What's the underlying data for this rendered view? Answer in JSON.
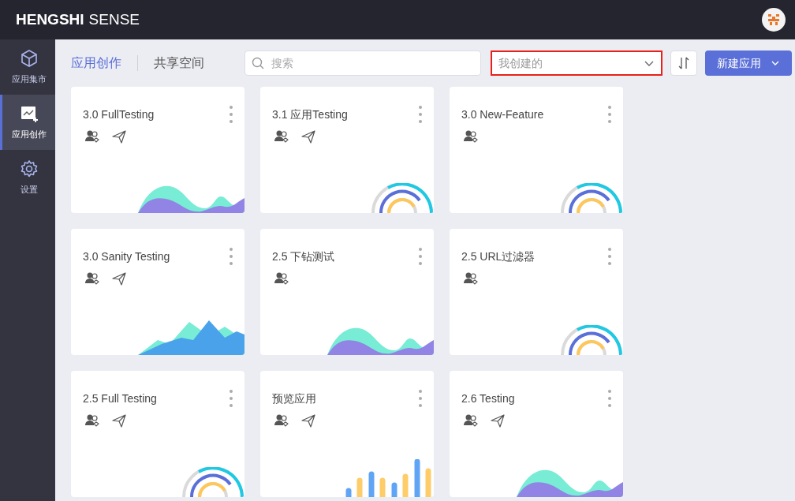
{
  "brand": {
    "bold": "HENGSHI",
    "light": "SENSE"
  },
  "sidebar": {
    "items": [
      {
        "label": "应用集市",
        "selected": false
      },
      {
        "label": "应用创作",
        "selected": true
      },
      {
        "label": "设置",
        "selected": false
      }
    ]
  },
  "tabs": [
    {
      "label": "应用创作",
      "selected": true
    },
    {
      "label": "共享空间",
      "selected": false
    }
  ],
  "search": {
    "placeholder": "搜索"
  },
  "filter": {
    "value": "我创建的",
    "highlighted": true
  },
  "new_button": "新建应用",
  "apps": [
    {
      "title": "3.0 FullTesting",
      "published": true,
      "kind": "wave"
    },
    {
      "title": "3.1 应用Testing",
      "published": true,
      "kind": "rings"
    },
    {
      "title": "3.0 New-Feature",
      "published": false,
      "kind": "rings"
    },
    {
      "title": "3.0 Sanity Testing",
      "published": true,
      "kind": "mountain"
    },
    {
      "title": "2.5 下钻测试",
      "published": false,
      "kind": "wave"
    },
    {
      "title": "2.5 URL过滤器",
      "published": false,
      "kind": "rings"
    },
    {
      "title": "2.5 Full Testing",
      "published": true,
      "kind": "rings"
    },
    {
      "title": "预览应用",
      "published": true,
      "kind": "bars"
    },
    {
      "title": "2.6 Testing",
      "published": true,
      "kind": "wave"
    }
  ]
}
